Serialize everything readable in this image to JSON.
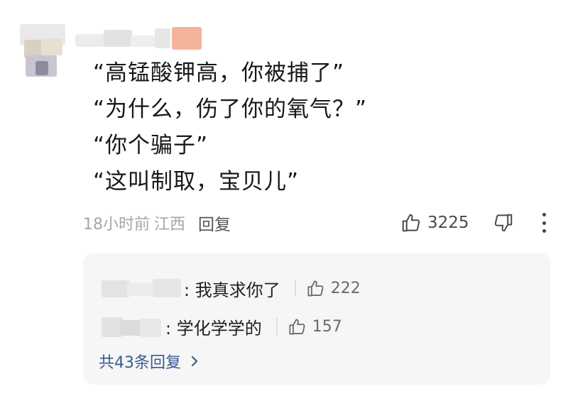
{
  "comment": {
    "lines": [
      "“高锰酸钾高，你被捕了”",
      "“为什么，伤了你的氧气？”",
      "“你个骗子”",
      "“这叫制取，宝贝儿”"
    ],
    "time": "18小时前",
    "location": "江西",
    "reply_label": "回复",
    "like_count": "3225"
  },
  "replies": {
    "items": [
      {
        "text": ": 我真求你了",
        "like_count": "222"
      },
      {
        "text": ": 学化学学的",
        "like_count": "157"
      }
    ],
    "more_label": "共43条回复"
  },
  "icons": {
    "like": "thumbs-up-icon",
    "dislike": "thumbs-down-icon",
    "more": "more-vertical-icon",
    "chevron": "chevron-right-icon"
  },
  "colors": {
    "link": "#3c5a8f",
    "meta": "#a6a6a6",
    "reply_bg": "#f6f6f6"
  }
}
